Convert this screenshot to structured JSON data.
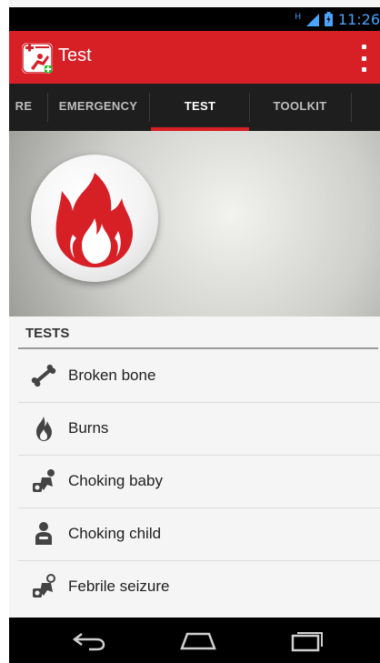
{
  "status_bar": {
    "time": "11:26",
    "network_type": "H",
    "signal_icon": "signal-icon",
    "battery_icon": "battery-icon"
  },
  "action_bar": {
    "title": "Test",
    "app_icon": "first-aid-app-icon",
    "overflow_icon": "overflow-menu-icon"
  },
  "tabs": [
    {
      "label": "RE",
      "active": false
    },
    {
      "label": "EMERGENCY",
      "active": false
    },
    {
      "label": "TEST",
      "active": true
    },
    {
      "label": "TOOLKIT",
      "active": false
    }
  ],
  "hero": {
    "icon": "fire-icon"
  },
  "section": {
    "title": "TESTS"
  },
  "tests": [
    {
      "label": "Broken bone",
      "icon": "bone-icon"
    },
    {
      "label": "Burns",
      "icon": "flame-icon"
    },
    {
      "label": "Choking baby",
      "icon": "choking-baby-icon"
    },
    {
      "label": "Choking child",
      "icon": "choking-child-icon"
    },
    {
      "label": "Febrile seizure",
      "icon": "febrile-seizure-icon"
    }
  ],
  "nav_bar": {
    "back": "back-icon",
    "home": "home-icon",
    "recents": "recents-icon"
  },
  "colors": {
    "brand_red": "#d71f26",
    "tab_bar": "#1e1e1e",
    "status_time": "#4aa3ff"
  }
}
